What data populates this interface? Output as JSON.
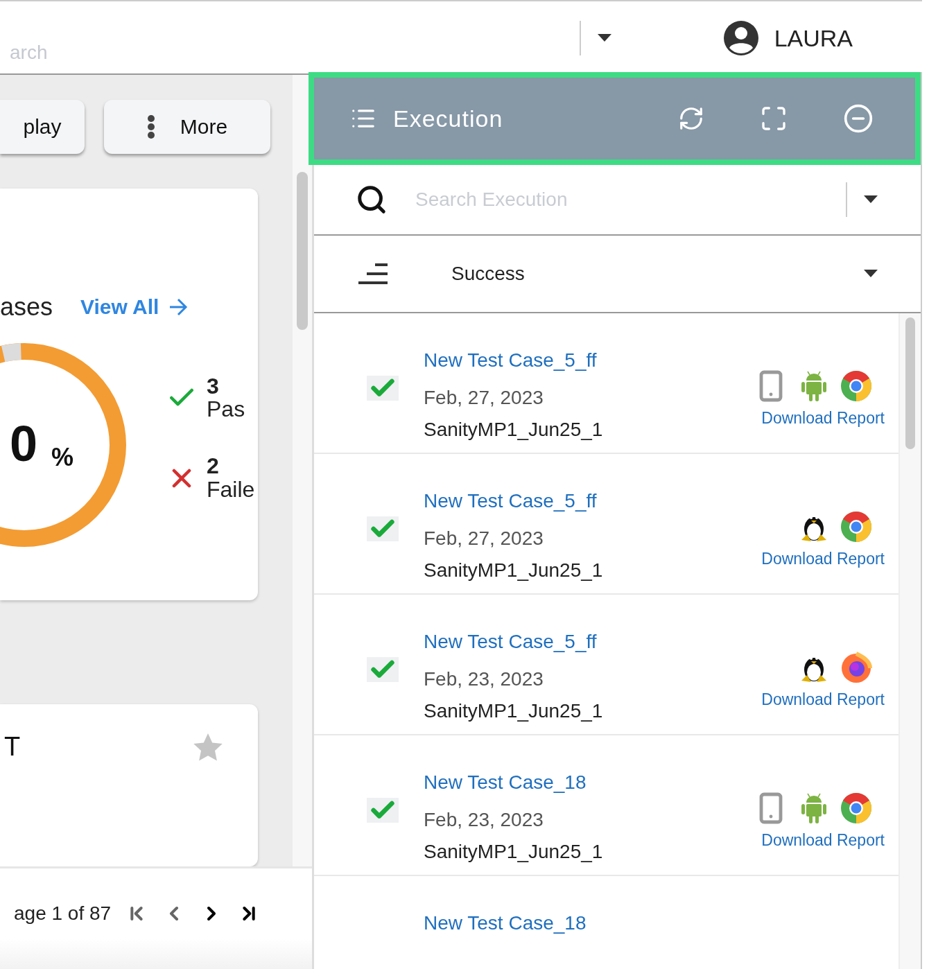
{
  "top_bar": {
    "search_placeholder": "arch",
    "user": "LAURA"
  },
  "toolbar": {
    "buttons": [
      {
        "label": "play",
        "kind": "plain"
      },
      {
        "label": "More",
        "kind": "menu"
      }
    ]
  },
  "summary_card": {
    "title": "ases",
    "link": "View All",
    "percent_value": "0",
    "percent_sign": "%",
    "legend": [
      {
        "kind": "passed",
        "count": "3",
        "label": "Pas"
      },
      {
        "kind": "failed",
        "count": "2",
        "label": "Faile"
      }
    ]
  },
  "favorite_card": {
    "title": "T",
    "starred": false
  },
  "pagination": {
    "text": "age 1 of 87",
    "nav": [
      {
        "kind": "first",
        "disabled": true
      },
      {
        "kind": "prev",
        "disabled": true
      },
      {
        "kind": "next",
        "disabled": false
      },
      {
        "kind": "last",
        "disabled": false
      }
    ]
  },
  "execution_panel": {
    "title": "Execution",
    "search": {
      "placeholder": "Search Execution"
    },
    "filter": {
      "value": "Success"
    },
    "rows": [
      {
        "title": "New Test Case_5_ff",
        "date": "Feb, 27, 2023",
        "suite": "SanityMP1_Jun25_1",
        "passed": true,
        "platforms": [
          {
            "kind": "mobile"
          },
          {
            "kind": "android"
          },
          {
            "kind": "chrome"
          }
        ],
        "action": "Download Report"
      },
      {
        "title": "New Test Case_5_ff",
        "date": "Feb, 27, 2023",
        "suite": "SanityMP1_Jun25_1",
        "passed": true,
        "platforms": [
          {
            "kind": "linux"
          },
          {
            "kind": "chrome"
          }
        ],
        "action": "Download Report"
      },
      {
        "title": "New Test Case_5_ff",
        "date": "Feb, 23, 2023",
        "suite": "SanityMP1_Jun25_1",
        "passed": true,
        "platforms": [
          {
            "kind": "linux"
          },
          {
            "kind": "firefox"
          }
        ],
        "action": "Download Report"
      },
      {
        "title": "New Test Case_18",
        "date": "Feb, 23, 2023",
        "suite": "SanityMP1_Jun25_1",
        "passed": true,
        "platforms": [
          {
            "kind": "mobile"
          },
          {
            "kind": "android"
          },
          {
            "kind": "chrome"
          }
        ],
        "action": "Download Report"
      },
      {
        "title": "New Test Case_18"
      }
    ]
  }
}
